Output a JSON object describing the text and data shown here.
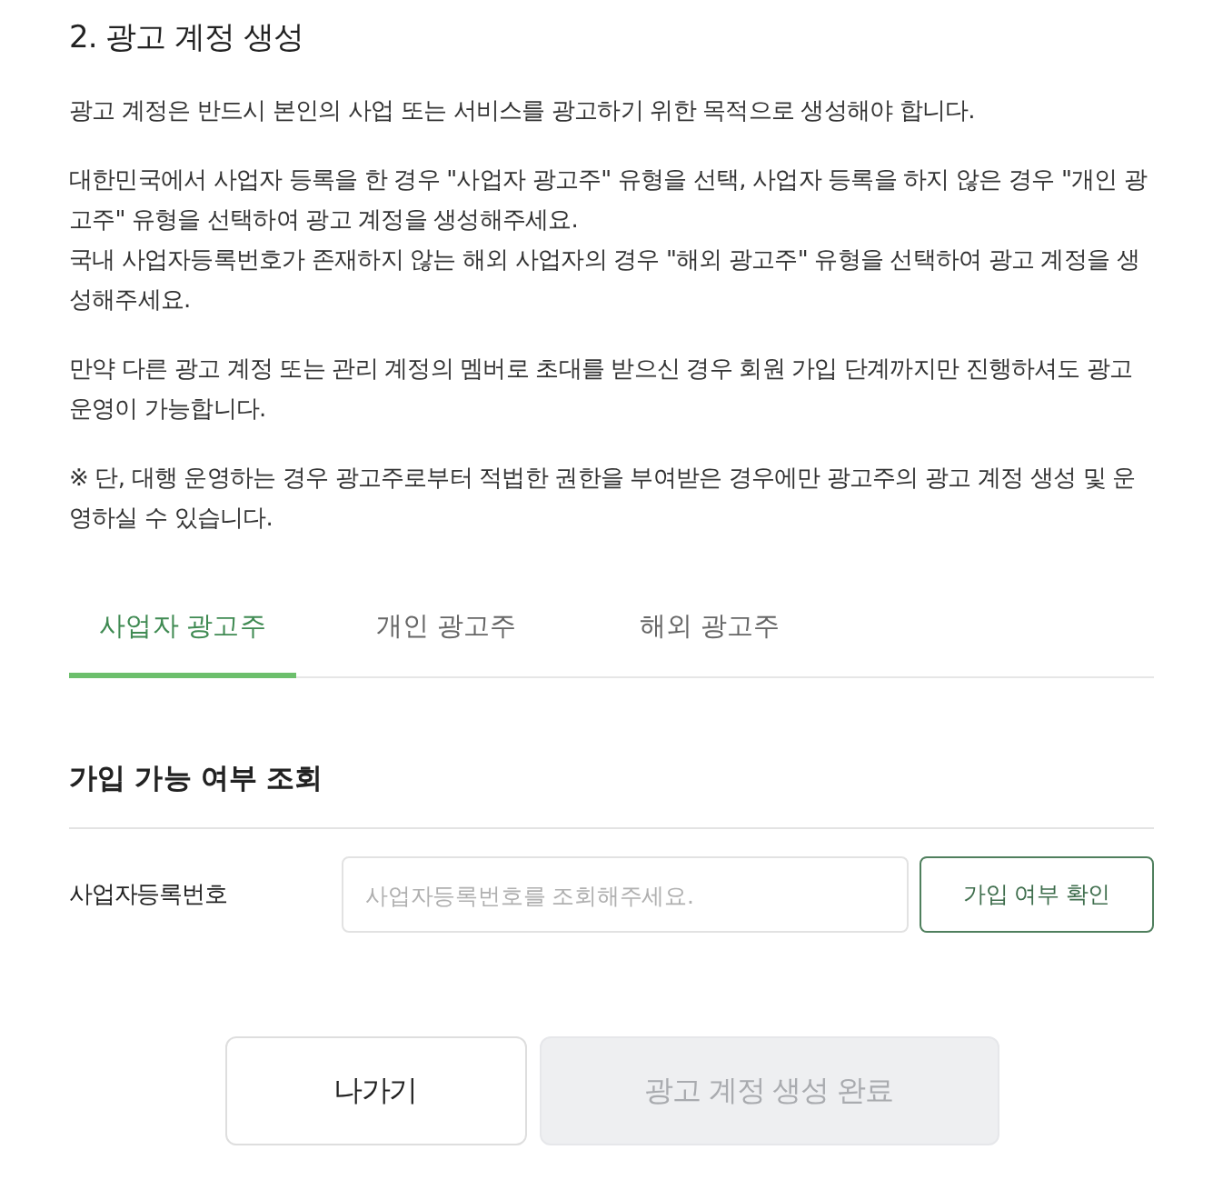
{
  "heading": "2. 광고 계정 생성",
  "paragraphs": [
    {
      "lines": [
        "광고 계정은 반드시 본인의 사업 또는 서비스를 광고하기 위한 목적으로 생성해야 합니다."
      ]
    },
    {
      "lines": [
        "대한민국에서 사업자 등록을 한 경우 \"사업자 광고주\" 유형을 선택, 사업자 등록을 하지 않은 경우 \"개인 광고주\" 유형을 선택하여 광고 계정을 생성해주세요.",
        "국내 사업자등록번호가 존재하지 않는 해외 사업자의 경우 \"해외 광고주\" 유형을 선택하여 광고 계정을 생성해주세요."
      ]
    },
    {
      "lines": [
        "만약 다른 광고 계정 또는 관리 계정의 멤버로 초대를 받으신 경우 회원 가입 단계까지만 진행하셔도 광고 운영이 가능합니다."
      ]
    },
    {
      "lines": [
        "※ 단, 대행 운영하는 경우 광고주로부터 적법한 권한을 부여받은 경우에만 광고주의 광고 계정 생성 및 운영하실 수 있습니다."
      ]
    }
  ],
  "tabs": [
    {
      "label": "사업자 광고주",
      "selected": true
    },
    {
      "label": "개인 광고주",
      "selected": false
    },
    {
      "label": "해외 광고주",
      "selected": false
    }
  ],
  "lookup": {
    "title": "가입 가능 여부 조회",
    "field_label": "사업자등록번호",
    "input": {
      "placeholder": "사업자등록번호를 조회해주세요."
    },
    "check_button": "가입 여부 확인"
  },
  "actions": [
    {
      "label": "나가기",
      "disabled": false
    },
    {
      "label": "광고 계정 생성 완료",
      "disabled": true
    }
  ]
}
